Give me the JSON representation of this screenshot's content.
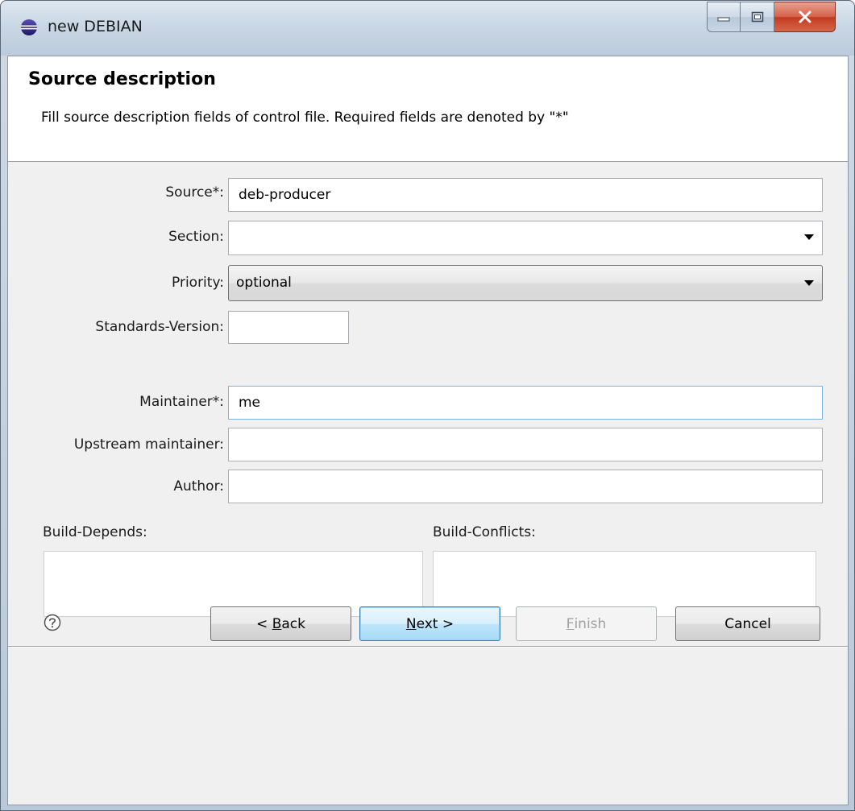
{
  "window": {
    "title": "new DEBIAN",
    "app_icon": "eclipse-icon",
    "caption_buttons": [
      "minimize-icon",
      "maximize-icon",
      "close-icon"
    ]
  },
  "header": {
    "title": "Source description",
    "description": "Fill source description fields of control file. Required fields are denoted by \"*\""
  },
  "form": {
    "source": {
      "label": "Source*:",
      "value": "deb-producer"
    },
    "section": {
      "label": "Section:",
      "value": ""
    },
    "priority": {
      "label": "Priority:",
      "value": "optional"
    },
    "standards_version": {
      "label": "Standards-Version:",
      "value": ""
    },
    "maintainer": {
      "label": "Maintainer*:",
      "value": "me"
    },
    "upstream_maintainer": {
      "label": "Upstream maintainer:",
      "value": ""
    },
    "author": {
      "label": "Author:",
      "value": ""
    },
    "build_depends": {
      "label": "Build-Depends:",
      "value": ""
    },
    "build_conflicts": {
      "label": "Build-Conflicts:",
      "value": ""
    }
  },
  "footer": {
    "help_icon": "help-icon",
    "back": {
      "prefix": "< ",
      "mnemonic": "B",
      "rest": "ack"
    },
    "next": {
      "mnemonic": "N",
      "rest": "ext >"
    },
    "finish": {
      "mnemonic": "F",
      "rest": "inish"
    },
    "cancel": {
      "label": "Cancel"
    }
  }
}
